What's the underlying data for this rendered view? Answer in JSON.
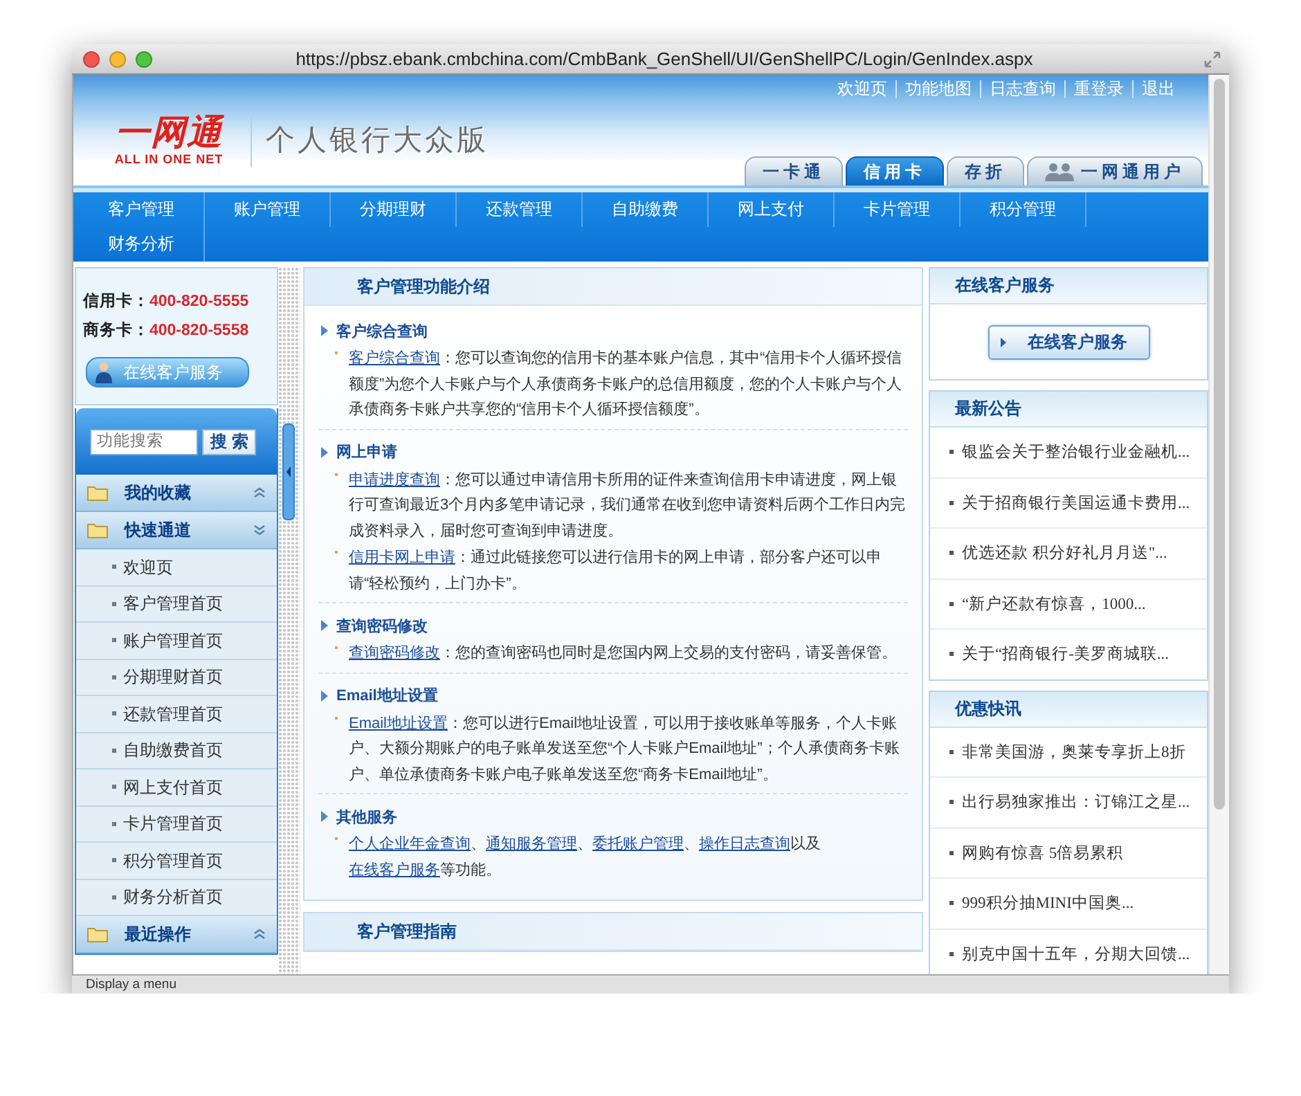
{
  "browser": {
    "url": "https://pbsz.ebank.cmbchina.com/CmbBank_GenShell/UI/GenShellPC/Login/GenIndex.aspx",
    "status": "Display a menu"
  },
  "header": {
    "logo_cn": "一网通",
    "logo_en": "ALL IN ONE NET",
    "title": "个人银行大众版",
    "links": [
      "欢迎页",
      "功能地图",
      "日志查询",
      "重登录",
      "退出"
    ],
    "tabs": [
      {
        "label": "一卡通",
        "selected": false,
        "kind": "plain"
      },
      {
        "label": "信用卡",
        "selected": true,
        "kind": "plain"
      },
      {
        "label": "存折",
        "selected": false,
        "kind": "plain"
      },
      {
        "label": "一网通用户",
        "selected": false,
        "kind": "user"
      }
    ]
  },
  "nav": [
    "客户管理",
    "账户管理",
    "分期理财",
    "还款管理",
    "自助缴费",
    "网上支付",
    "卡片管理",
    "积分管理",
    "财务分析"
  ],
  "sidebar": {
    "hotlines": [
      {
        "label": "信用卡：",
        "number": "400-820-5555"
      },
      {
        "label": "商务卡：",
        "number": "400-820-5558"
      }
    ],
    "service_button": "在线客户服务",
    "search": {
      "placeholder": "功能搜索",
      "button": "搜 索"
    },
    "groups": [
      {
        "label": "我的收藏",
        "expanded": false
      },
      {
        "label": "快速通道",
        "expanded": true,
        "children": [
          "欢迎页",
          "客户管理首页",
          "账户管理首页",
          "分期理财首页",
          "还款管理首页",
          "自助缴费首页",
          "网上支付首页",
          "卡片管理首页",
          "积分管理首页",
          "财务分析首页"
        ]
      },
      {
        "label": "最近操作",
        "expanded": false
      }
    ]
  },
  "main": {
    "panels": [
      {
        "title": "客户管理功能介绍",
        "sections": [
          {
            "heading": "客户综合查询",
            "entries": [
              {
                "parts": [
                  {
                    "kind": "link",
                    "text": "客户综合查询"
                  },
                  {
                    "kind": "text",
                    "text": "：您可以查询您的信用卡的基本账户信息，其中“信用卡个人循环授信额度”为您个人卡账户与个人承债商务卡账户的总信用额度，您的个人卡账户与个人承债商务卡账户共享您的“信用卡个人循环授信额度”。"
                  }
                ]
              }
            ]
          },
          {
            "heading": "网上申请",
            "entries": [
              {
                "parts": [
                  {
                    "kind": "link",
                    "text": "申请进度查询"
                  },
                  {
                    "kind": "text",
                    "text": "：您可以通过申请信用卡所用的证件来查询信用卡申请进度，网上银行可查询最近3个月内多笔申请记录，我们通常在收到您申请资料后两个工作日内完成资料录入，届时您可查询到申请进度。"
                  }
                ]
              },
              {
                "parts": [
                  {
                    "kind": "link",
                    "text": "信用卡网上申请"
                  },
                  {
                    "kind": "text",
                    "text": "：通过此链接您可以进行信用卡的网上申请，部分客户还可以申请“轻松预约，上门办卡”。"
                  }
                ]
              }
            ]
          },
          {
            "heading": "查询密码修改",
            "entries": [
              {
                "parts": [
                  {
                    "kind": "link",
                    "text": "查询密码修改"
                  },
                  {
                    "kind": "text",
                    "text": "：您的查询密码也同时是您国内网上交易的支付密码，请妥善保管。"
                  }
                ]
              }
            ]
          },
          {
            "heading": "Email地址设置",
            "entries": [
              {
                "parts": [
                  {
                    "kind": "link",
                    "text": "Email地址设置"
                  },
                  {
                    "kind": "text",
                    "text": "：您可以进行Email地址设置，可以用于接收账单等服务，个人卡账户、大额分期账户的电子账单发送至您“个人卡账户Email地址”；个人承债商务卡账户、单位承债商务卡账户电子账单发送至您“商务卡Email地址”。"
                  }
                ]
              }
            ]
          },
          {
            "heading": "其他服务",
            "entries": [
              {
                "parts": [
                  {
                    "kind": "link",
                    "text": "个人企业年金查询"
                  },
                  {
                    "kind": "text",
                    "text": "、"
                  },
                  {
                    "kind": "link",
                    "text": "通知服务管理"
                  },
                  {
                    "kind": "text",
                    "text": "、"
                  },
                  {
                    "kind": "link",
                    "text": "委托账户管理"
                  },
                  {
                    "kind": "text",
                    "text": "、"
                  },
                  {
                    "kind": "link",
                    "text": "操作日志查询"
                  },
                  {
                    "kind": "text",
                    "text": "以及"
                  },
                  {
                    "kind": "link",
                    "text": "在线客户服务"
                  },
                  {
                    "kind": "text",
                    "text": "等功能。"
                  }
                ]
              }
            ]
          }
        ]
      },
      {
        "title": "客户管理指南"
      }
    ]
  },
  "right": {
    "service": {
      "title": "在线客户服务",
      "button": "在线客户服务"
    },
    "lists": [
      {
        "title": "最新公告",
        "items": [
          "银监会关于整治银行业金融机...",
          "关于招商银行美国运通卡费用...",
          "优选还款 积分好礼月月送\"...",
          "“新户还款有惊喜，1000...",
          "关于“招商银行-美罗商城联..."
        ]
      },
      {
        "title": "优惠快讯",
        "items": [
          "非常美国游，奥莱专享折上8折",
          "出行易独家推出：订锦江之星...",
          "网购有惊喜 5倍易累积",
          "999积分抽MINI中国奥...",
          "别克中国十五年，分期大回馈..."
        ]
      }
    ]
  }
}
